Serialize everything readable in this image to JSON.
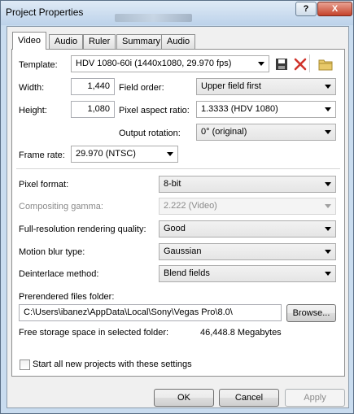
{
  "window": {
    "title": "Project Properties",
    "help_label": "?",
    "close_label": "X"
  },
  "tabs": [
    {
      "label": "Video"
    },
    {
      "label": "Audio"
    },
    {
      "label": "Ruler"
    },
    {
      "label": "Summary"
    },
    {
      "label": "Audio CD"
    }
  ],
  "video": {
    "template_label": "Template:",
    "template_value": "HDV 1080-60i (1440x1080, 29.970 fps)",
    "width_label": "Width:",
    "width_value": "1,440",
    "height_label": "Height:",
    "height_value": "1,080",
    "field_order_label": "Field order:",
    "field_order_value": "Upper field first",
    "pixel_aspect_label": "Pixel aspect ratio:",
    "pixel_aspect_value": "1.3333 (HDV 1080)",
    "output_rotation_label": "Output rotation:",
    "output_rotation_value": "0° (original)",
    "frame_rate_label": "Frame rate:",
    "frame_rate_value": "29.970 (NTSC)",
    "pixel_format_label": "Pixel format:",
    "pixel_format_value": "8-bit",
    "compositing_gamma_label": "Compositing gamma:",
    "compositing_gamma_value": "2.222 (Video)",
    "render_quality_label": "Full-resolution rendering quality:",
    "render_quality_value": "Good",
    "motion_blur_label": "Motion blur type:",
    "motion_blur_value": "Gaussian",
    "deinterlace_label": "Deinterlace method:",
    "deinterlace_value": "Blend fields",
    "prerender_folder_label": "Prerendered files folder:",
    "prerender_folder_value": "C:\\Users\\ibanez\\AppData\\Local\\Sony\\Vegas Pro\\8.0\\",
    "browse_label": "Browse...",
    "free_space_label": "Free storage space in selected folder:",
    "free_space_value": "46,448.8 Megabytes",
    "start_all_label": "Start all new projects with these settings"
  },
  "buttons": {
    "ok": "OK",
    "cancel": "Cancel",
    "apply": "Apply"
  },
  "colors": {
    "delete_icon": "#d0342c",
    "folder_icon": "#e8c96a",
    "save_icon": "#3a3a3a"
  }
}
